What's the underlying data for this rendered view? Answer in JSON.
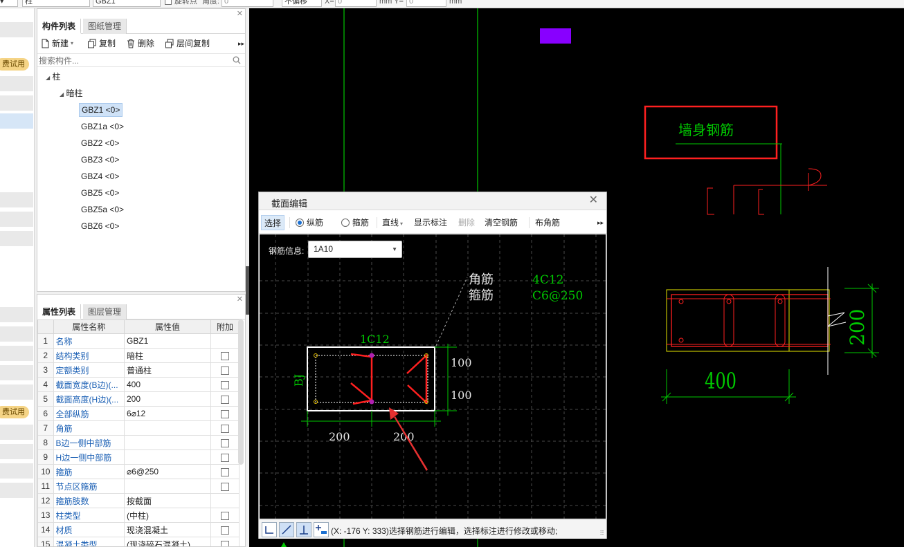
{
  "topbar": {
    "combo_type": "柱",
    "combo_name": "GBZ1",
    "rotate_label": "旋转点",
    "angle_label": "角度:",
    "angle_value": "0",
    "offset_combo": "不偏移",
    "x_label": "X=",
    "x_value": "0",
    "mm1": "mm Y=",
    "y_value": "0",
    "mm2": "mm"
  },
  "leftstrip": {
    "trial_label_1": "费试用",
    "trial_label_2": "费试用"
  },
  "component_panel": {
    "tab_components": "构件列表",
    "tab_drawings": "图纸管理",
    "new_label": "新建",
    "copy_label": "复制",
    "delete_label": "删除",
    "floor_copy_label": "层间复制",
    "search_placeholder": "搜索构件...",
    "tree_root": "柱",
    "tree_group": "暗柱",
    "items": [
      "GBZ1 <0>",
      "GBZ1a <0>",
      "GBZ2 <0>",
      "GBZ3 <0>",
      "GBZ4 <0>",
      "GBZ5 <0>",
      "GBZ5a <0>",
      "GBZ6 <0>"
    ]
  },
  "property_panel": {
    "tab_properties": "属性列表",
    "tab_layers": "图层管理",
    "col_name": "属性名称",
    "col_value": "属性值",
    "col_extra": "附加",
    "rows": [
      {
        "num": "1",
        "name": "名称",
        "value": "GBZ1",
        "checkbox": false
      },
      {
        "num": "2",
        "name": "结构类别",
        "value": "暗柱",
        "checkbox": true
      },
      {
        "num": "3",
        "name": "定额类别",
        "value": "普通柱",
        "checkbox": true
      },
      {
        "num": "4",
        "name": "截面宽度(B边)(...",
        "value": "400",
        "checkbox": true
      },
      {
        "num": "5",
        "name": "截面高度(H边)(...",
        "value": "200",
        "checkbox": true
      },
      {
        "num": "6",
        "name": "全部纵筋",
        "value": "6⌀12",
        "checkbox": true
      },
      {
        "num": "7",
        "name": "角筋",
        "value": "",
        "checkbox": true
      },
      {
        "num": "8",
        "name": "B边一侧中部筋",
        "value": "",
        "checkbox": true
      },
      {
        "num": "9",
        "name": "H边一侧中部筋",
        "value": "",
        "checkbox": true
      },
      {
        "num": "10",
        "name": "箍筋",
        "value": "⌀6@250",
        "checkbox": true
      },
      {
        "num": "11",
        "name": "节点区箍筋",
        "value": "",
        "checkbox": true
      },
      {
        "num": "12",
        "name": "箍筋肢数",
        "value": "按截面",
        "checkbox": false
      },
      {
        "num": "13",
        "name": "柱类型",
        "value": "(中柱)",
        "checkbox": true
      },
      {
        "num": "14",
        "name": "材质",
        "value": "现浇混凝土",
        "checkbox": true
      },
      {
        "num": "15",
        "name": "混凝土类型",
        "value": "(现浇碎石混凝土)",
        "checkbox": true
      }
    ]
  },
  "canvas": {
    "wall_rebar_label": "墙身钢筋",
    "dim_400": "400",
    "dim_200": "200"
  },
  "dialog": {
    "title": "截面编辑",
    "select_label": "选择",
    "longitudinal_label": "纵筋",
    "stirrup_label": "箍筋",
    "line_label": "直线",
    "show_dim_label": "显示标注",
    "delete_label": "删除",
    "clear_label": "清空钢筋",
    "corner_label": "布角筋",
    "rebar_info_label": "钢筋信息:",
    "rebar_info_value": "1A10",
    "corner_text": "角筋",
    "stirrup_text": "箍筋",
    "corner_spec": "4C12",
    "stirrup_spec": "C6@250",
    "top_spec": "1C12",
    "side_spec": "BJ",
    "dim_h1": "100",
    "dim_h2": "100",
    "dim_w1": "200",
    "dim_w2": "200",
    "status": "(X: -176 Y: 333)选择钢筋进行编辑，选择标注进行修改或移动;"
  }
}
